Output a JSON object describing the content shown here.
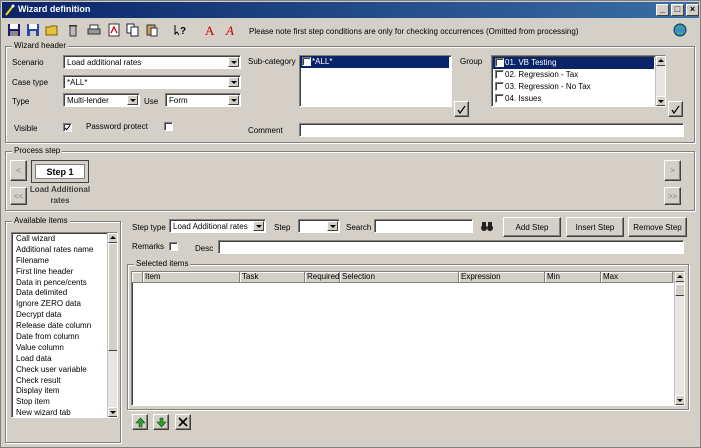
{
  "window": {
    "title": "Wizard definition"
  },
  "toolbar": {
    "note": "Please note first step conditions are only for checking occurrences (Omitted from processing)",
    "icons": [
      "save-icon",
      "save-as-icon",
      "open-folder-icon",
      "delete-icon",
      "print-icon",
      "pdf-icon",
      "copy-icon",
      "paste-icon",
      "help-icon",
      "font-a-icon",
      "font-a-italic-icon",
      "globe-icon"
    ]
  },
  "wizard_header": {
    "legend": "Wizard header",
    "scenario_label": "Scenario",
    "scenario_value": "Load additional rates",
    "case_type_label": "Case type",
    "case_type_value": "*ALL*",
    "type_label": "Type",
    "type_value": "Multi-lender",
    "use_label": "Use",
    "use_value": "Form",
    "visible_label": "Visible",
    "password_label": "Password protect",
    "subcategory_label": "Sub-category",
    "subcategory_items": [
      "*ALL*"
    ],
    "group_label": "Group",
    "group_items": [
      "01. VB Testing",
      "02. Regression - Tax",
      "03. Regression - No Tax",
      "04. Issues"
    ],
    "comment_label": "Comment",
    "comment_value": ""
  },
  "process_step": {
    "legend": "Process step",
    "step_label": "Step 1",
    "step_caption": "Load Additional rates",
    "nav_prev": "<",
    "nav_first": "<<",
    "nav_next": ">",
    "nav_last": ">>"
  },
  "available_items": {
    "legend": "Available items",
    "items": [
      "Call wizard",
      "Additional rates name",
      "Filename",
      "First line header",
      "Data in pence/cents",
      "Data delimited",
      "Ignore ZERO data",
      "Decrypt data",
      "Release date column",
      "Date from column",
      "Value column",
      "Load data",
      "Check user variable",
      "Check result",
      "Display item",
      "Stop item",
      "New wizard tab"
    ]
  },
  "step_form": {
    "step_type_label": "Step type",
    "step_type_value": "Load Additional rates",
    "step_label": "Step",
    "step_value": "",
    "search_label": "Search",
    "search_value": "",
    "add_step": "Add Step",
    "insert_step": "Insert Step",
    "remove_step": "Remove Step",
    "remarks_label": "Remarks",
    "desc_label": "Desc",
    "desc_value": ""
  },
  "selected_items": {
    "legend": "Selected items",
    "columns": [
      "Item",
      "Task",
      "Required",
      "Selection",
      "Expression",
      "Min",
      "Max"
    ]
  },
  "colors": {
    "title_bar": "#0a246a",
    "selection": "#0a246a",
    "face": "#d4d0c8",
    "move_arrow": "#2e9e2e",
    "delete_x": "#000000"
  }
}
